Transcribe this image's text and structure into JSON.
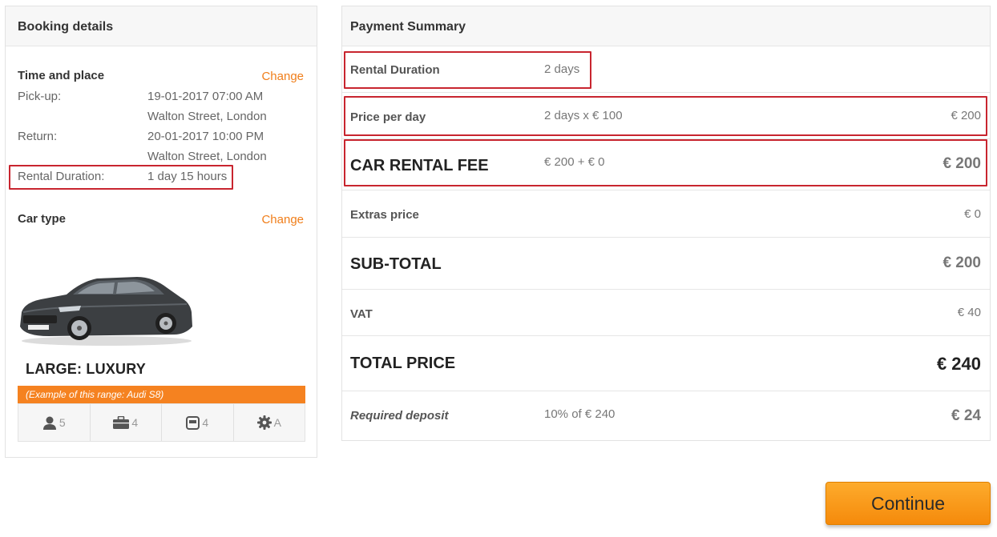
{
  "booking": {
    "title": "Booking details",
    "time_place": {
      "heading": "Time and place",
      "change_label": "Change",
      "pickup_label": "Pick-up:",
      "pickup_datetime": "19-01-2017 07:00 AM",
      "pickup_location": "Walton Street, London",
      "return_label": "Return:",
      "return_datetime": "20-01-2017 10:00 PM",
      "return_location": "Walton Street, London",
      "duration_label": "Rental Duration:",
      "duration_value": "1 day 15 hours"
    },
    "car": {
      "heading": "Car type",
      "change_label": "Change",
      "name": "LARGE: LUXURY",
      "example": "(Example of this range: Audi S8)",
      "features": [
        {
          "icon": "person-icon",
          "value": "5"
        },
        {
          "icon": "suitcase-icon",
          "value": "4"
        },
        {
          "icon": "door-icon",
          "value": "4"
        },
        {
          "icon": "gear-icon",
          "value": "A"
        }
      ]
    }
  },
  "payment": {
    "title": "Payment Summary",
    "rows": {
      "duration": {
        "label": "Rental Duration",
        "detail": "2 days"
      },
      "price_per_day": {
        "label": "Price per day",
        "detail": "2 days x € 100",
        "amount": "€ 200"
      },
      "rental_fee": {
        "label": "CAR RENTAL FEE",
        "detail": "€ 200 + € 0",
        "amount": "€ 200"
      },
      "extras": {
        "label": "Extras price",
        "amount": "€ 0"
      },
      "subtotal": {
        "label": "SUB-TOTAL",
        "amount": "€ 200"
      },
      "vat": {
        "label": "VAT",
        "amount": "€ 40"
      },
      "total": {
        "label": "TOTAL PRICE",
        "amount": "€ 240"
      },
      "deposit": {
        "label": "Required deposit",
        "detail": "10% of € 240",
        "amount": "€ 24"
      }
    }
  },
  "actions": {
    "continue_label": "Continue"
  },
  "colors": {
    "accent": "#f07e1a",
    "highlight_border": "#c8252f",
    "button_top": "#fdab2c",
    "button_bottom": "#f58a0b"
  }
}
